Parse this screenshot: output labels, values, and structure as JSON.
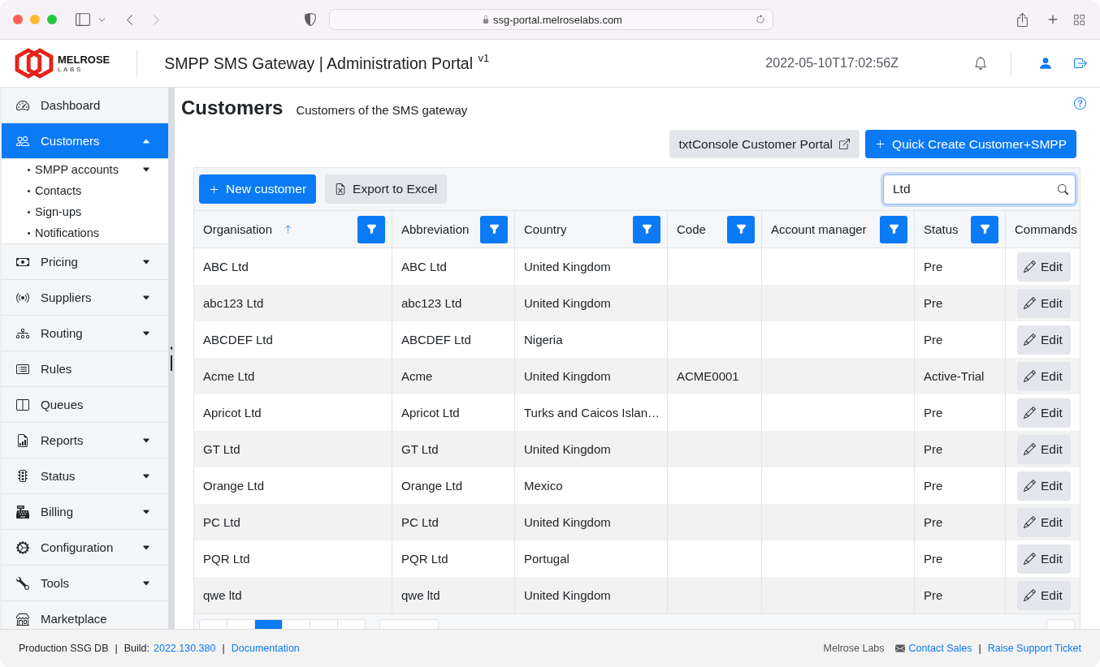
{
  "browser": {
    "url": "ssg-portal.melroselabs.com"
  },
  "header": {
    "brand": "MELROSE",
    "brand_sub": "LABS",
    "title": "SMPP SMS Gateway | Administration Portal $^{v1}$",
    "timestamp": "2022-05-10T17:02:56Z"
  },
  "sidebar": {
    "items": [
      {
        "label": "Dashboard",
        "selected": false
      },
      {
        "label": "Customers",
        "selected": true,
        "expanded": true,
        "children": [
          {
            "label": "SMPP accounts",
            "selected": false,
            "expanded": false
          },
          {
            "label": "Contacts",
            "selected": false
          },
          {
            "label": "Sign-ups",
            "selected": false
          },
          {
            "label": "Notifications",
            "selected": false
          }
        ]
      },
      {
        "label": "Pricing",
        "selected": false,
        "expanded": false
      },
      {
        "label": "Suppliers",
        "selected": false,
        "expanded": false
      },
      {
        "label": "Routing",
        "selected": false,
        "expanded": false
      },
      {
        "label": "Rules",
        "selected": false
      },
      {
        "label": "Queues",
        "selected": false
      },
      {
        "label": "Reports",
        "selected": false,
        "expanded": false
      },
      {
        "label": "Status",
        "selected": false,
        "expanded": false
      },
      {
        "label": "Billing",
        "selected": false,
        "expanded": false
      },
      {
        "label": "Configuration",
        "selected": false,
        "expanded": false
      },
      {
        "label": "Tools",
        "selected": false,
        "expanded": false
      },
      {
        "label": "Marketplace",
        "selected": false
      }
    ]
  },
  "page": {
    "title": "Customers",
    "subtitle": "Customers of the SMS gateway",
    "actions": [
      {
        "label": "txtConsole Customer Portal",
        "kind": "external"
      },
      {
        "label": "Quick Create Customer+SMPP",
        "kind": "create"
      }
    ]
  },
  "grid": {
    "toolbar": [
      {
        "label": "New customer",
        "kind": "create"
      },
      {
        "label": "Export to Excel",
        "kind": "export"
      }
    ],
    "search": {
      "value": "Ltd"
    },
    "columns": [
      {
        "label": "Organisation",
        "kind": "data",
        "sorted": true,
        "filterable": true
      },
      {
        "label": "Abbreviation",
        "kind": "data",
        "sorted": false,
        "filterable": true
      },
      {
        "label": "Country",
        "kind": "data",
        "sorted": false,
        "filterable": true
      },
      {
        "label": "Code",
        "kind": "data",
        "sorted": false,
        "filterable": true
      },
      {
        "label": "Account manager",
        "kind": "data",
        "sorted": false,
        "filterable": true
      },
      {
        "label": "Status",
        "kind": "data",
        "sorted": false,
        "filterable": true
      },
      {
        "label": "Commands",
        "kind": "command",
        "sorted": false,
        "filterable": false
      }
    ],
    "rows": [
      {
        "organisation": "ABC Ltd",
        "abbreviation": "ABC Ltd",
        "country": "United Kingdom",
        "status": "Pre",
        "command": "Edit"
      },
      {
        "organisation": "abc123 Ltd",
        "abbreviation": "abc123 Ltd",
        "country": "United Kingdom",
        "status": "Pre",
        "command": "Edit"
      },
      {
        "organisation": "ABCDEF Ltd",
        "abbreviation": "ABCDEF Ltd",
        "country": "Nigeria",
        "status": "Pre",
        "command": "Edit"
      },
      {
        "organisation": "Acme Ltd",
        "abbreviation": "Acme",
        "country": "United Kingdom",
        "code": "ACME0001",
        "status": "Active-Trial",
        "command": "Edit"
      },
      {
        "organisation": "Apricot Ltd",
        "abbreviation": "Apricot Ltd",
        "country": "Turks and Caicos Islan…",
        "status": "Pre",
        "command": "Edit"
      },
      {
        "organisation": "GT Ltd",
        "abbreviation": "GT Ltd",
        "country": "United Kingdom",
        "status": "Pre",
        "command": "Edit"
      },
      {
        "organisation": "Orange Ltd",
        "abbreviation": "Orange Ltd",
        "country": "Mexico",
        "status": "Pre",
        "command": "Edit"
      },
      {
        "organisation": "PC Ltd",
        "abbreviation": "PC Ltd",
        "country": "United Kingdom",
        "status": "Pre",
        "command": "Edit"
      },
      {
        "organisation": "PQR Ltd",
        "abbreviation": "PQR Ltd",
        "country": "Portugal",
        "status": "Pre",
        "command": "Edit"
      },
      {
        "organisation": "qwe ltd",
        "abbreviation": "qwe ltd",
        "country": "United Kingdom",
        "status": "Pre",
        "command": "Edit"
      }
    ],
    "pagination": {
      "pages": [
        {
          "selected": false
        },
        {
          "selected": false
        },
        {
          "selected": true
        },
        {
          "selected": false
        },
        {
          "selected": false
        },
        {
          "selected": false
        }
      ]
    }
  },
  "footer": {
    "left": [
      {
        "text": "Production SSG DB",
        "kind": "text"
      },
      {
        "text": "|",
        "kind": "separator"
      },
      {
        "text": "Build:",
        "kind": "text"
      },
      {
        "text": "2022.130.380",
        "kind": "link"
      },
      {
        "text": "|",
        "kind": "separator"
      },
      {
        "text": "Documentation",
        "kind": "link"
      }
    ],
    "right": [
      {
        "text": "Melrose Labs",
        "kind": "muted"
      },
      {
        "text": "Contact Sales",
        "kind": "mail-link"
      },
      {
        "text": "|",
        "kind": "separator"
      },
      {
        "text": "Raise Support Ticket",
        "kind": "link"
      }
    ]
  }
}
